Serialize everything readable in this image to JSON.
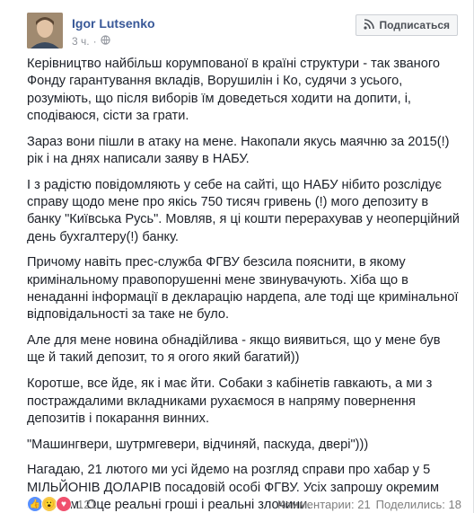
{
  "post": {
    "author": "Igor Lutsenko",
    "time": "3 ч.",
    "subscribe_label": "Подписаться",
    "paragraphs": [
      "Керівництво найбільш корумпованої в країні структури - так званого Фонду гарантування вкладів, Ворушилін і Ко, судячи з усього, розуміють, що після виборів їм доведеться ходити на допити, і, сподіваюся, сісти за грати.",
      "Зараз вони пішли в атаку на мене. Накопали якусь маячню за 2015(!) рік і на днях написали заяву в НАБУ.",
      "І з радістю повідомляють у себе на сайті, що НАБУ нібито розслідує справу щодо мене про якісь 750 тисяч гривень (!) мого депозиту в банку \"Київська Русь\". Мовляв, я ці кошти перерахував у неоперційний день бухгалтеру(!) банку.",
      "Причому навіть прес-служба ФГВУ безсила пояснити, в якому кримінальному правопорушенні мене звинувачують. Хіба що в ненаданні інформації в декларацію нардепа, але тоді ще кримінальної відповідальності за таке не було.",
      "Але для мене новина обнадійлива - якщо виявиться, що у мене був ще й такий депозит, то я огого який багатий))",
      "Коротше, все йде, як і має йти. Собаки з кабінетів гавкають, а ми з постраждалими вкладниками рухаємося в напряму повернення депозитів і покарання винних.",
      "\"Машингвери, шутрмгевери, відчиняй, паскуда, двері\")))",
      "Нагадаю, 21 лютого ми усі йдемо на розгляд справи про хабар у 5 МІЛЬЙОНІВ ДОЛАРІВ посадовій особі ФГВУ. Усіх запрошу окремим анонсом. Оце реальні гроші і реальні злочини."
    ]
  },
  "footer": {
    "reaction_count": "121",
    "comments": "Комментарии: 21",
    "shares": "Поделились: 18"
  },
  "colors": {
    "link": "#385898",
    "text": "#1d2129",
    "meta": "#90949c",
    "like": "#5890ff"
  },
  "icons": [
    "globe-icon",
    "like-reaction-icon",
    "wow-reaction-icon",
    "love-reaction-icon",
    "rss-icon"
  ]
}
